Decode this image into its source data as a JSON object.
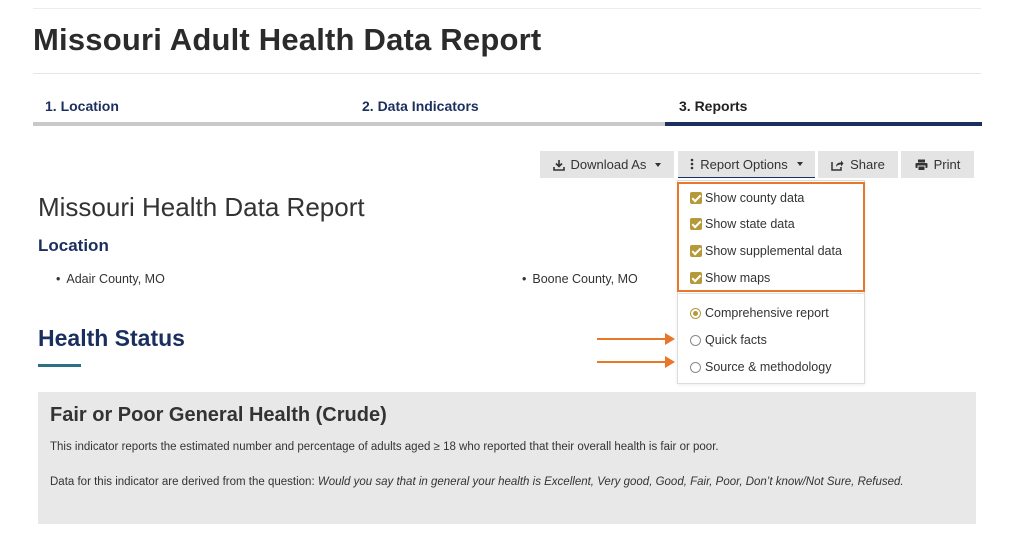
{
  "page": {
    "title": "Missouri Adult Health Data Report"
  },
  "steps": [
    {
      "label": "1. Location",
      "active": false
    },
    {
      "label": "2. Data Indicators",
      "active": false
    },
    {
      "label": "3. Reports",
      "active": true
    }
  ],
  "toolbar": {
    "download_label": "Download As",
    "report_options_label": "Report Options",
    "share_label": "Share",
    "print_label": "Print"
  },
  "report_options": {
    "checkboxes": [
      {
        "label": "Show county data",
        "checked": true
      },
      {
        "label": "Show state data",
        "checked": true
      },
      {
        "label": "Show supplemental data",
        "checked": true
      },
      {
        "label": "Show maps",
        "checked": true
      }
    ],
    "radios": [
      {
        "label": "Comprehensive report",
        "selected": true
      },
      {
        "label": "Quick facts",
        "selected": false
      },
      {
        "label": "Source & methodology",
        "selected": false
      }
    ]
  },
  "report": {
    "title": "Missouri Health Data Report",
    "location_heading": "Location",
    "locations": [
      "Adair County, MO",
      "Boone County, MO"
    ],
    "section_heading": "Health Status",
    "indicator": {
      "title": "Fair or Poor General Health (Crude)",
      "description": "This indicator reports the estimated number and percentage of adults aged ≥ 18 who reported that their overall health is fair or poor.",
      "question_prefix": "Data for this indicator are derived from the question: ",
      "question_text": "Would you say that in general your health is Excellent, Very good, Good, Fair, Poor, Don’t know/Not Sure, Refused."
    }
  },
  "colors": {
    "navy": "#1a2f5e",
    "highlight_orange": "#e8762b",
    "checkbox_gold": "#b59a3a",
    "indicator_bg": "#e8e8e8"
  }
}
